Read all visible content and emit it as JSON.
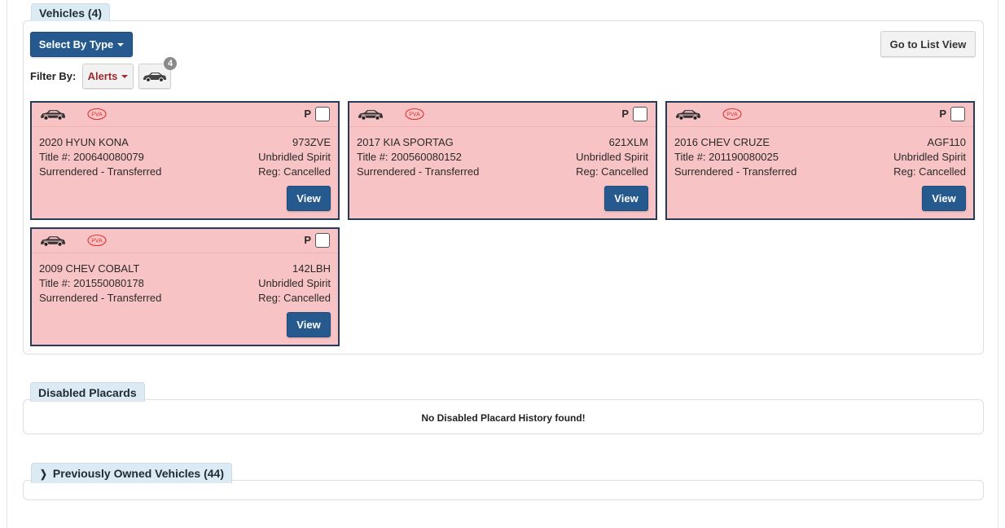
{
  "vehicles_section": {
    "tab_label": "Vehicles (4)",
    "select_by_type_label": "Select By Type",
    "list_view_label": "Go to List View",
    "filter_label": "Filter By:",
    "alerts_label": "Alerts",
    "car_filter_count": "4"
  },
  "vehicles": [
    {
      "name": "2020 HYUN KONA",
      "plate": "973ZVE",
      "title": "Title #: 200640080079",
      "plate_type": "Unbridled Spirit",
      "status": "Surrendered - Transferred",
      "reg": "Reg: Cancelled",
      "p_label": "P",
      "view_label": "View",
      "pva": "PVA"
    },
    {
      "name": "2017 KIA SPORTAG",
      "plate": "621XLM",
      "title": "Title #: 200560080152",
      "plate_type": "Unbridled Spirit",
      "status": "Surrendered - Transferred",
      "reg": "Reg: Cancelled",
      "p_label": "P",
      "view_label": "View",
      "pva": "PVA"
    },
    {
      "name": "2016 CHEV CRUZE",
      "plate": "AGF110",
      "title": "Title #: 201190080025",
      "plate_type": "Unbridled Spirit",
      "status": "Surrendered - Transferred",
      "reg": "Reg: Cancelled",
      "p_label": "P",
      "view_label": "View",
      "pva": "PVA"
    },
    {
      "name": "2009 CHEV COBALT",
      "plate": "142LBH",
      "title": "Title #: 201550080178",
      "plate_type": "Unbridled Spirit",
      "status": "Surrendered - Transferred",
      "reg": "Reg: Cancelled",
      "p_label": "P",
      "view_label": "View",
      "pva": "PVA"
    }
  ],
  "placards_section": {
    "tab_label": "Disabled Placards",
    "empty_message": "No Disabled Placard History found!"
  },
  "previous_section": {
    "tab_label": "Previously Owned Vehicles (44)",
    "chevron": "❯"
  },
  "colors": {
    "card_background": "#f8c3c5",
    "card_border": "#253b57",
    "primary_button": "#265a8f",
    "tab_background": "#dbeaf3",
    "alert_text": "#9b2b2b"
  }
}
